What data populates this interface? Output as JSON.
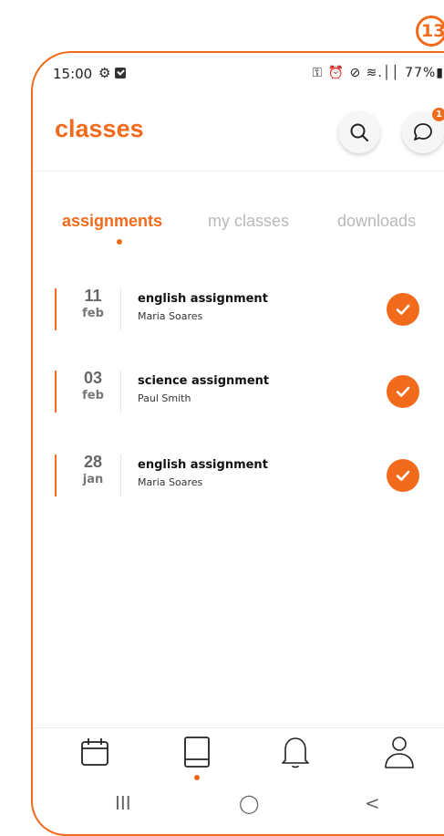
{
  "step_badge": "13",
  "status_bar": {
    "time": "15:00",
    "right_text": "⚿ ⏰ ⊘ ≋.││ 77%▮"
  },
  "header": {
    "title": "classes",
    "chat_badge_count": "1"
  },
  "tabs": [
    {
      "label": "assignments",
      "active": true
    },
    {
      "label": "my classes",
      "active": false
    },
    {
      "label": "downloads",
      "active": false
    }
  ],
  "assignments": [
    {
      "day": "11",
      "month": "feb",
      "name": "english assignment",
      "teacher": "Maria Soares",
      "done": true
    },
    {
      "day": "03",
      "month": "feb",
      "name": "science assignment",
      "teacher": "Paul Smith",
      "done": true
    },
    {
      "day": "28",
      "month": "jan",
      "name": "english assignment",
      "teacher": "Maria Soares",
      "done": true
    }
  ],
  "bottom_nav": [
    {
      "icon": "calendar-icon",
      "active": false
    },
    {
      "icon": "book-icon",
      "active": true
    },
    {
      "icon": "bell-icon",
      "active": false
    },
    {
      "icon": "profile-icon",
      "active": false
    }
  ],
  "system_nav": {
    "recents": "III",
    "home": "◯",
    "back": "<"
  },
  "colors": {
    "accent": "#f26a1b",
    "inactive_tab": "#b9b9b9",
    "text": "#111111"
  }
}
